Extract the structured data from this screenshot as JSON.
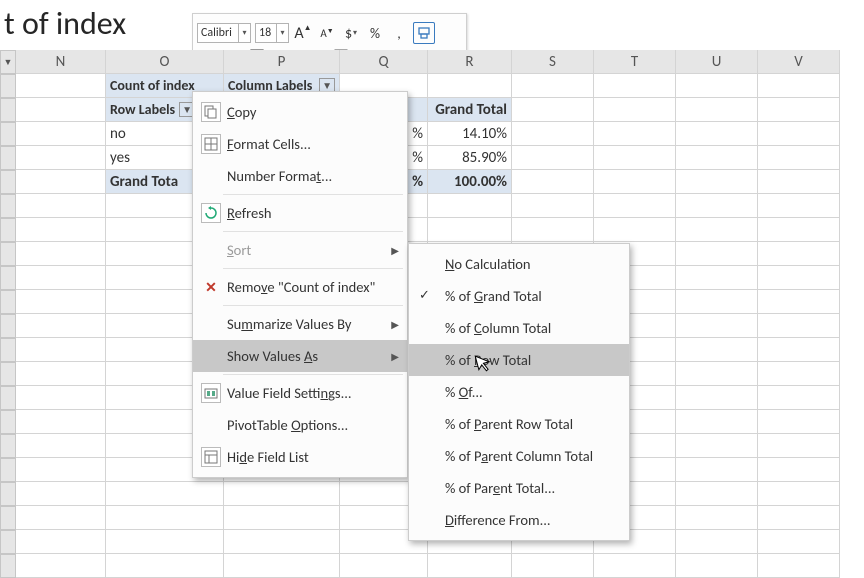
{
  "page_title_fragment": "t of index",
  "mini_toolbar": {
    "font_name": "Calibri",
    "font_size": "18"
  },
  "columns": [
    "N",
    "O",
    "P",
    "Q",
    "R",
    "S",
    "T",
    "U",
    "V"
  ],
  "pivot": {
    "count_label": "Count of index",
    "col_labels": "Column Labels",
    "row_labels": "Row Labels",
    "grand_total": "Grand Total",
    "rows": {
      "r1_label": "no",
      "r1_gt": "14.10%",
      "r2_label": "yes",
      "r2_gt": "85.90%",
      "gt_label": "Grand Tota",
      "gt_gt": "100.00%"
    },
    "pct_suffix": "%"
  },
  "context_menu": {
    "copy": "Copy",
    "format_cells": "Format Cells...",
    "number_format": "Number Format...",
    "refresh": "Refresh",
    "sort": "Sort",
    "remove": "Remove \"Count of index\"",
    "summarize": "Summarize Values By",
    "show_values_as": "Show Values As",
    "value_field_settings": "Value Field Settings...",
    "pt_options": "PivotTable Options...",
    "hide_field_list": "Hide Field List"
  },
  "submenu": {
    "no_calc": "No Calculation",
    "pct_grand_total": "% of Grand Total",
    "pct_col_total": "% of Column Total",
    "pct_row_total": "% of Row Total",
    "pct_of": "% Of...",
    "pct_parent_row": "% of Parent Row Total",
    "pct_parent_col": "% of Parent Column Total",
    "pct_parent_total": "% of Parent Total...",
    "diff_from": "Difference From..."
  }
}
